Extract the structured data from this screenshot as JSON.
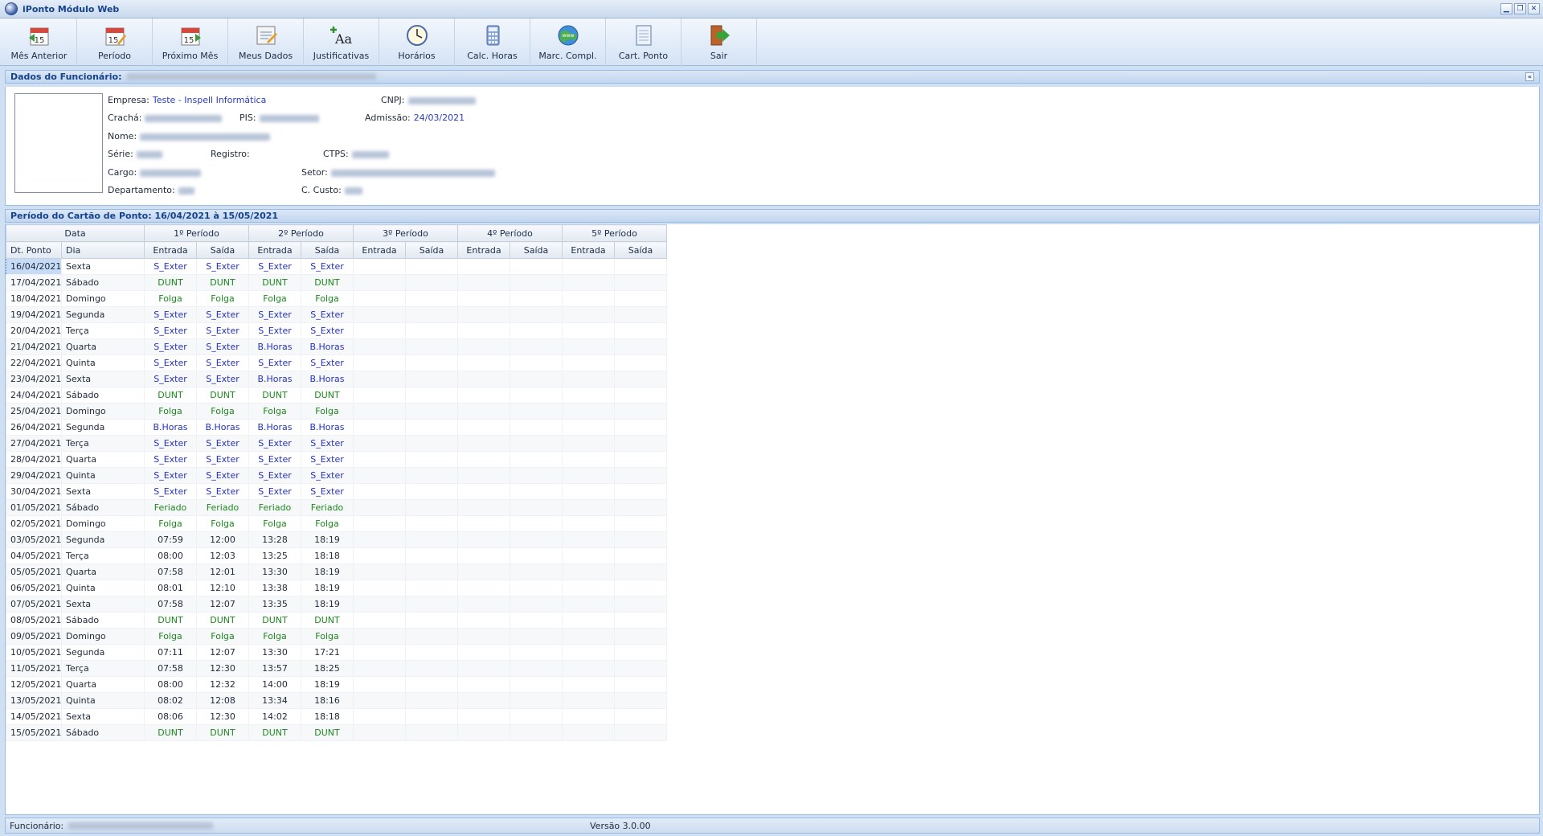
{
  "window": {
    "title": "iPonto Módulo Web"
  },
  "toolbar": [
    {
      "label": "Mês Anterior",
      "icon": "calendar-prev-icon"
    },
    {
      "label": "Período",
      "icon": "calendar-edit-icon"
    },
    {
      "label": "Próximo Mês",
      "icon": "calendar-next-icon"
    },
    {
      "label": "Meus Dados",
      "icon": "notepad-icon"
    },
    {
      "label": "Justificativas",
      "icon": "font-add-icon"
    },
    {
      "label": "Horários",
      "icon": "clock-icon"
    },
    {
      "label": "Calc. Horas",
      "icon": "calculator-icon"
    },
    {
      "label": "Marc. Compl.",
      "icon": "globe-icon"
    },
    {
      "label": "Cart. Ponto",
      "icon": "card-icon"
    },
    {
      "label": "Sair",
      "icon": "exit-door-icon"
    }
  ],
  "employee": {
    "header": "Dados do Funcionário:",
    "empresa_label": "Empresa:",
    "empresa": "Teste - Inspell Informática",
    "cnpj_label": "CNPJ:",
    "cracha_label": "Crachá:",
    "pis_label": "PIS:",
    "admissao_label": "Admissão:",
    "admissao": "24/03/2021",
    "nome_label": "Nome:",
    "serie_label": "Série:",
    "registro_label": "Registro:",
    "ctps_label": "CTPS:",
    "cargo_label": "Cargo:",
    "setor_label": "Setor:",
    "departamento_label": "Departamento:",
    "ccusto_label": "C. Custo:"
  },
  "period": {
    "header": "Período do Cartão de Ponto: 16/04/2021 à 15/05/2021"
  },
  "grid": {
    "group_headers": [
      "Data",
      "1º Período",
      "2º Período",
      "3º Período",
      "4º Período",
      "5º Período"
    ],
    "sub_headers": [
      "Dt. Ponto",
      "Dia",
      "Entrada",
      "Saída",
      "Entrada",
      "Saída",
      "Entrada",
      "Saída",
      "Entrada",
      "Saída",
      "Entrada",
      "Saída"
    ],
    "rows": [
      [
        "16/04/2021",
        "Sexta",
        "S_Exter",
        "S_Exter",
        "S_Exter",
        "S_Exter"
      ],
      [
        "17/04/2021",
        "Sábado",
        "DUNT",
        "DUNT",
        "DUNT",
        "DUNT"
      ],
      [
        "18/04/2021",
        "Domingo",
        "Folga",
        "Folga",
        "Folga",
        "Folga"
      ],
      [
        "19/04/2021",
        "Segunda",
        "S_Exter",
        "S_Exter",
        "S_Exter",
        "S_Exter"
      ],
      [
        "20/04/2021",
        "Terça",
        "S_Exter",
        "S_Exter",
        "S_Exter",
        "S_Exter"
      ],
      [
        "21/04/2021",
        "Quarta",
        "S_Exter",
        "S_Exter",
        "B.Horas",
        "B.Horas"
      ],
      [
        "22/04/2021",
        "Quinta",
        "S_Exter",
        "S_Exter",
        "S_Exter",
        "S_Exter"
      ],
      [
        "23/04/2021",
        "Sexta",
        "S_Exter",
        "S_Exter",
        "B.Horas",
        "B.Horas"
      ],
      [
        "24/04/2021",
        "Sábado",
        "DUNT",
        "DUNT",
        "DUNT",
        "DUNT"
      ],
      [
        "25/04/2021",
        "Domingo",
        "Folga",
        "Folga",
        "Folga",
        "Folga"
      ],
      [
        "26/04/2021",
        "Segunda",
        "B.Horas",
        "B.Horas",
        "B.Horas",
        "B.Horas"
      ],
      [
        "27/04/2021",
        "Terça",
        "S_Exter",
        "S_Exter",
        "S_Exter",
        "S_Exter"
      ],
      [
        "28/04/2021",
        "Quarta",
        "S_Exter",
        "S_Exter",
        "S_Exter",
        "S_Exter"
      ],
      [
        "29/04/2021",
        "Quinta",
        "S_Exter",
        "S_Exter",
        "S_Exter",
        "S_Exter"
      ],
      [
        "30/04/2021",
        "Sexta",
        "S_Exter",
        "S_Exter",
        "S_Exter",
        "S_Exter"
      ],
      [
        "01/05/2021",
        "Sábado",
        "Feriado",
        "Feriado",
        "Feriado",
        "Feriado"
      ],
      [
        "02/05/2021",
        "Domingo",
        "Folga",
        "Folga",
        "Folga",
        "Folga"
      ],
      [
        "03/05/2021",
        "Segunda",
        "07:59",
        "12:00",
        "13:28",
        "18:19"
      ],
      [
        "04/05/2021",
        "Terça",
        "08:00",
        "12:03",
        "13:25",
        "18:18"
      ],
      [
        "05/05/2021",
        "Quarta",
        "07:58",
        "12:01",
        "13:30",
        "18:19"
      ],
      [
        "06/05/2021",
        "Quinta",
        "08:01",
        "12:10",
        "13:38",
        "18:19"
      ],
      [
        "07/05/2021",
        "Sexta",
        "07:58",
        "12:07",
        "13:35",
        "18:19"
      ],
      [
        "08/05/2021",
        "Sábado",
        "DUNT",
        "DUNT",
        "DUNT",
        "DUNT"
      ],
      [
        "09/05/2021",
        "Domingo",
        "Folga",
        "Folga",
        "Folga",
        "Folga"
      ],
      [
        "10/05/2021",
        "Segunda",
        "07:11",
        "12:07",
        "13:30",
        "17:21"
      ],
      [
        "11/05/2021",
        "Terça",
        "07:58",
        "12:30",
        "13:57",
        "18:25"
      ],
      [
        "12/05/2021",
        "Quarta",
        "08:00",
        "12:32",
        "14:00",
        "18:19"
      ],
      [
        "13/05/2021",
        "Quinta",
        "08:02",
        "12:08",
        "13:34",
        "18:16"
      ],
      [
        "14/05/2021",
        "Sexta",
        "08:06",
        "12:30",
        "14:02",
        "18:18"
      ],
      [
        "15/05/2021",
        "Sábado",
        "DUNT",
        "DUNT",
        "DUNT",
        "DUNT"
      ]
    ]
  },
  "status": {
    "funcionario_label": "Funcionário:",
    "version": "Versão 3.0.00"
  },
  "colors": {
    "blue_text": "#2431c4",
    "green_text": "#1a8a1a",
    "header_blue": "#15428b"
  }
}
